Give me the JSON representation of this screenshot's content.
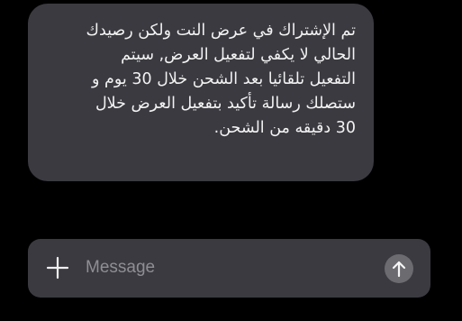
{
  "conversation": {
    "received_message": {
      "lines": [
        "تم الإشتراك في عرض النت ولكن رصيدك",
        "الحالي لا يكفي لتفعيل العرض, سيتم",
        "التفعيل تلقائيا بعد الشحن خلال 30 يوم  و",
        "ستصلك رسالة تأكيد بتفعيل العرض خلال",
        "30 دقيقه من الشحن."
      ],
      "bubble_color": "#3a3a40",
      "text_color": "#f2f2f2"
    }
  },
  "composer": {
    "placeholder": "Message",
    "value": "",
    "add_icon": "plus-icon",
    "send_icon": "arrow-up-icon",
    "background_color": "#3a3a40"
  }
}
